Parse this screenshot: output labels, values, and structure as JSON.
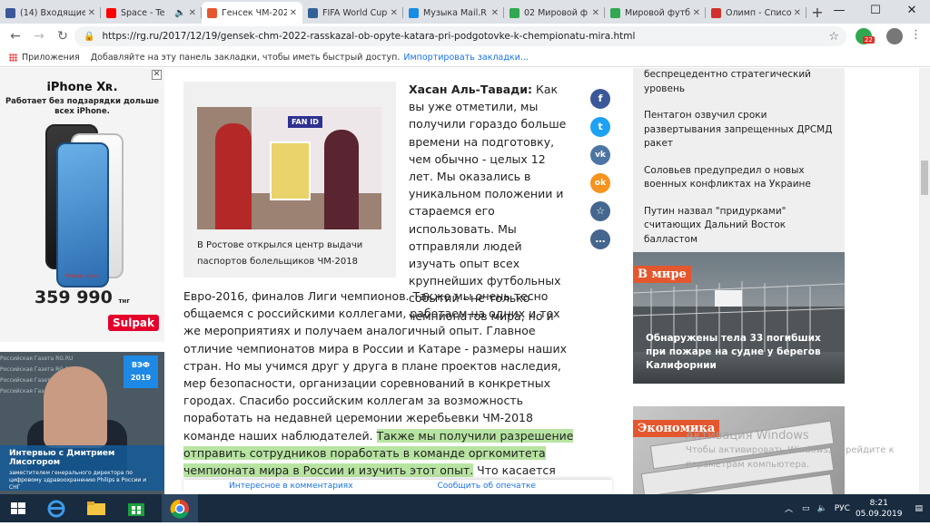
{
  "browser": {
    "tabs": [
      {
        "label": "(14) Входящие",
        "color": "#3b5998",
        "active": false
      },
      {
        "label": "Space - Te",
        "color": "#ff0000",
        "active": false,
        "has_audio": true
      },
      {
        "label": "Генсек ЧМ-202",
        "color": "#e4572e",
        "active": true
      },
      {
        "label": "FIFA World Cup",
        "color": "#326295",
        "active": false
      },
      {
        "label": "Музыка Mail.R",
        "color": "#168de2",
        "active": false
      },
      {
        "label": "02 Мировой ф",
        "color": "#2fa84f",
        "active": false
      },
      {
        "label": "Мировой футб",
        "color": "#2fa84f",
        "active": false
      },
      {
        "label": "Олимп - Списо",
        "color": "#d0312d",
        "active": false
      }
    ],
    "new_tab": "+",
    "window_controls": {
      "minimize": "—",
      "maximize": "☐",
      "close": "✕"
    },
    "url": "https://rg.ru/2017/12/19/gensek-chm-2022-rasskazal-ob-opyte-katara-pri-podgotovke-k-chempionatu-mira.html",
    "extension_badge": "22",
    "bookmarks": {
      "apps_label": "Приложения",
      "prompt": "Добавляйте на эту панель закладки, чтобы иметь быстрый доступ.",
      "import_link": "Импортировать закладки..."
    }
  },
  "ad_phone": {
    "title": "iPhone Xʀ.",
    "subtitle": "Работает без подзарядки дольше всех iPhone.",
    "small": "Новая цена",
    "price": "359 990",
    "currency": "тнг",
    "brand": "Sulpak"
  },
  "ad_video": {
    "bg_text": [
      "Российская Газета  RG.RU",
      "Российская Газета  RG.RU",
      "Российская Газета  RG.RU",
      "Российская Газета  RG.RU"
    ],
    "badge_line1": "ВЭФ",
    "badge_line2": "2019",
    "caption_title": "Интервью с Дмитрием Лисогором",
    "caption_sub": "заместителем генерального директора по цифровому здравоохранению Philips в России и СНГ"
  },
  "article": {
    "photo_sign": "FAN ID",
    "photo_caption": "В Ростове открылся центр выдачи паспортов болельщиков ЧМ-2018",
    "speaker": "Хасан Аль-Тавади:",
    "lead": " Как вы уже отметили, мы получили гораздо больше времени на подготовку, чем обычно - целых 12 лет. Мы оказались в уникальном положении и стараемся его использовать. Мы отправляли людей изучать опыт всех крупнейших футбольных событий - не только чемпионатов мира, но и",
    "body_plain": "Евро-2016, финалов Лиги чемпионов. Также мы очень тесно общаемся с российскими коллегами, работаем на одних и тех же мероприятиях и получаем аналогичный опыт. Главное отличие чемпионатов мира в России и Катаре - размеры наших стран. Но мы учимся друг у друга в плане проектов наследия, мер безопасности, организации соревнований в конкретных городах. Спасибо российским коллегам за возможность поработать на недавней церемонии жеребьевки ЧМ-2018 команде наших наблюдателей.",
    "body_highlight": "Также мы получили разрешение отправить сотрудников поработать в команде оргкомитета чемпионата мира в России и изучить этот опыт.",
    "body_tail": " Что касается подготовки, то она идет, на мой взгляд, очень хорошо. Мы уже могли убедиться в эт...м по тем мероприятиям"
  },
  "bottom_strip": {
    "left": "Интересное в комментариях",
    "right": "Сообщить об опечатке"
  },
  "share": [
    {
      "icon": "facebook-icon",
      "glyph": "f",
      "color": "#3b5998"
    },
    {
      "icon": "twitter-icon",
      "glyph": "t",
      "color": "#1da1f2"
    },
    {
      "icon": "vk-icon",
      "glyph": "vk",
      "color": "#4c75a3"
    },
    {
      "icon": "odnoklassniki-icon",
      "glyph": "ok",
      "color": "#f7931e"
    },
    {
      "icon": "star-icon",
      "glyph": "☆",
      "color": "#45668e"
    },
    {
      "icon": "comment-icon",
      "glyph": "…",
      "color": "#45668e"
    }
  ],
  "sidebar": {
    "news": [
      "беспрецедентно стратегический уровень",
      "Пентагон озвучил сроки развертывания запрещенных ДРСМД ракет",
      "Соловьев предупредил о новых военных конфликтах на Украине",
      "Путин назвал \"придурками\" считающих Дальний Восток балластом"
    ],
    "card1": {
      "label": "В мире",
      "title": "Обнаружены тела 33 погибших при пожаре на судне у берегов Калифорнии"
    },
    "card2": {
      "label": "Экономика"
    }
  },
  "watermark": {
    "line1": "Активация Windows",
    "line2": "Чтобы активировать Windows, перейдите к",
    "line3": "параметрам компьютера."
  },
  "taskbar": {
    "lang": "РУС",
    "time": "8:21",
    "date": "05.09.2019"
  },
  "colors": {
    "rg_accent": "#e4572e",
    "highlight": "#b7e4a1",
    "taskbar": "#182b3f"
  }
}
